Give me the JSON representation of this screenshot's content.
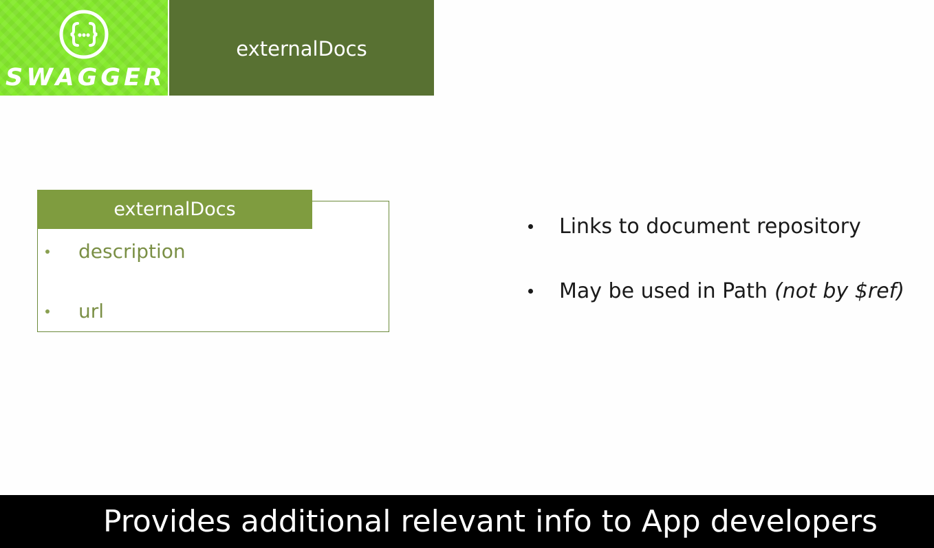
{
  "logo": {
    "wordmark": "SWAGGER",
    "icon": "swagger-braces-icon",
    "colors": {
      "background": "#85ea2d",
      "mark": "#ffffff"
    }
  },
  "header": {
    "title": "externalDocs",
    "background": "#587132"
  },
  "object_box": {
    "title": "externalDocs",
    "fields": [
      "description",
      "url"
    ],
    "accent": "#7f9c3f"
  },
  "bullets": [
    {
      "text": "Links to document repository",
      "note": ""
    },
    {
      "text": "May be used in Path",
      "note": "(not by $ref)"
    }
  ],
  "caption": {
    "text": "Provides additional relevant info to App developers"
  }
}
